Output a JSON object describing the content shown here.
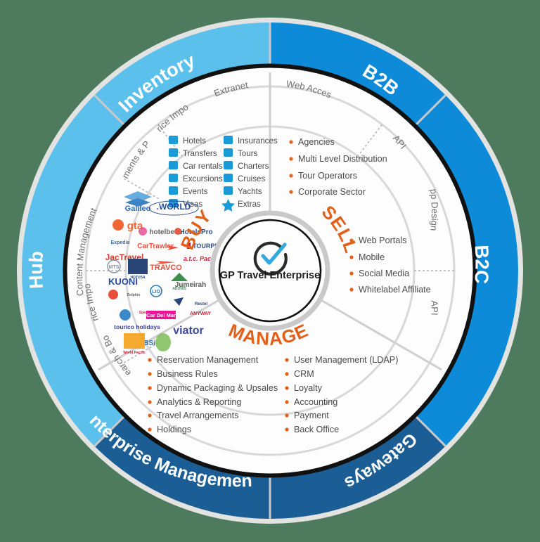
{
  "diagram": {
    "title": "GP Travel Enterprise",
    "center": {
      "label": "GP Travel Enterprise",
      "icon": "check-circle-icon"
    },
    "colors": {
      "background": "#4e7a5e",
      "light_blue": "#5bc0ec",
      "mid_blue": "#0d8bd9",
      "dark_blue": "#1b5e95",
      "orange": "#e2601a",
      "grey_ring": "#c9c9c9",
      "text_grey": "#6f6f6f"
    },
    "outer_segments": [
      {
        "label": "Inventory",
        "color": "#5bc0ec"
      },
      {
        "label": "B2B",
        "color": "#0d8bd9"
      },
      {
        "label": "B2C",
        "color": "#0d8bd9"
      },
      {
        "label": "Gateways",
        "color": "#1b5e95"
      },
      {
        "label": "Enterprise Management",
        "color": "#1b5e95"
      },
      {
        "label": "Hub",
        "color": "#5bc0ec"
      }
    ],
    "inner_ring_labels": [
      {
        "label": "Price Import",
        "side": "inventory"
      },
      {
        "label": "Extranet",
        "side": "inventory"
      },
      {
        "label": "Allotments & Prices",
        "side": "inventory"
      },
      {
        "label": "Web Access",
        "side": "b2b"
      },
      {
        "label": "API",
        "side": "b2b"
      },
      {
        "label": "App Designer",
        "side": "b2c"
      },
      {
        "label": "API",
        "side": "b2c"
      },
      {
        "label": "Content Management",
        "side": "hub"
      },
      {
        "label": "Price Import",
        "side": "hub"
      },
      {
        "label": "Search & Book",
        "side": "hub"
      }
    ],
    "verbs": [
      {
        "label": "BUY",
        "color": "#e2601a"
      },
      {
        "label": "SELL",
        "color": "#e2601a"
      },
      {
        "label": "MANAGE",
        "color": "#e2601a"
      }
    ],
    "inventory_items_left": [
      {
        "icon": "hotels-icon",
        "label": "Hotels"
      },
      {
        "icon": "transfers-icon",
        "label": "Transfers"
      },
      {
        "icon": "car-rentals-icon",
        "label": "Car rentals"
      },
      {
        "icon": "excursions-icon",
        "label": "Excursions"
      },
      {
        "icon": "events-icon",
        "label": "Events"
      },
      {
        "icon": "visas-icon",
        "label": "Visas"
      }
    ],
    "inventory_items_right": [
      {
        "icon": "insurances-icon",
        "label": "Insurances"
      },
      {
        "icon": "tours-icon",
        "label": "Tours"
      },
      {
        "icon": "charters-icon",
        "label": "Charters"
      },
      {
        "icon": "cruises-icon",
        "label": "Cruises"
      },
      {
        "icon": "yachts-icon",
        "label": "Yachts"
      },
      {
        "icon": "extras-icon",
        "label": "Extras"
      }
    ],
    "b2b_bullets": [
      "Agencies",
      "Multi Level Distribution",
      "Tour Operators",
      "Corporate Sector"
    ],
    "b2c_bullets": [
      "Web Portals",
      "Mobile",
      "Social Media",
      "Whitelabel Affiliate"
    ],
    "manage_bullets_left": [
      "Reservation Management",
      "Business Rules",
      "Dynamic Packaging & Upsales",
      "Analytics & Reporting",
      "Travel Arrangements",
      "Holdings"
    ],
    "manage_bullets_right": [
      "User Management (LDAP)",
      "CRM",
      "Loyalty",
      "Accounting",
      "Payment",
      "Back Office"
    ],
    "hub_logos": [
      "Galileo",
      ".WORLD",
      "gta",
      "hotelbeds",
      "HotelsPro",
      "Expedia",
      "CarTrawler",
      "TOURPLAN",
      "JacTravel",
      "MTS",
      "HOTUSA",
      "TRAVCO",
      "a.t.c. Pacific",
      "KUONI",
      "Dolphin",
      "Jumeirah",
      "Special Tours",
      "ADONIS",
      "Restel",
      "LIO",
      "Car Del Mar",
      "ANYWAY",
      "tourico holidays",
      "viator",
      "HBSi",
      "World Pacific"
    ]
  }
}
